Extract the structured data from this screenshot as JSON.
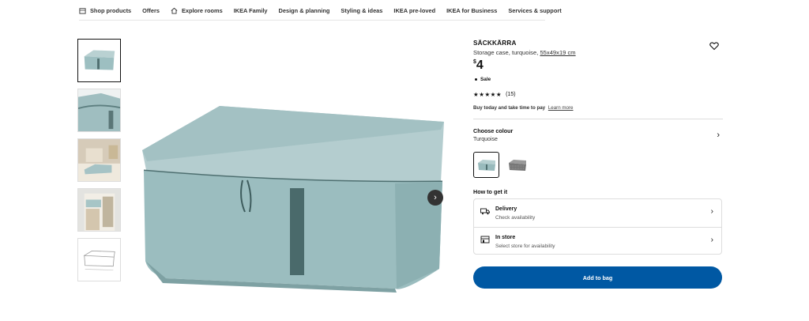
{
  "nav": {
    "items": [
      {
        "label": "Shop products",
        "icon": "menu-icon"
      },
      {
        "label": "Offers"
      },
      {
        "label": "Explore rooms",
        "icon": "home-icon"
      },
      {
        "label": "IKEA Family"
      },
      {
        "label": "Design & planning"
      },
      {
        "label": "Styling & ideas"
      },
      {
        "label": "IKEA pre-loved"
      },
      {
        "label": "IKEA for Business"
      },
      {
        "label": "Services & support"
      }
    ]
  },
  "gallery": {
    "thumbnails": [
      "storage-case-front",
      "storage-case-closeup",
      "bedroom-scene",
      "wardrobe-scene",
      "dimension-drawing"
    ],
    "active_index": 0
  },
  "product": {
    "name": "SÄCKKÄRRA",
    "description": "Storage case, turquoise,",
    "dimensions": "55x49x19 cm",
    "currency": "$",
    "price": "4",
    "sale_label": "Sale",
    "stars": "★★★★★",
    "review_count": "(15)",
    "pay_later": "Buy today and take time to pay",
    "learn_more": "Learn more"
  },
  "colour": {
    "title": "Choose colour",
    "value": "Turquoise",
    "swatches": [
      {
        "name": "turquoise",
        "color": "#a9c6c8"
      },
      {
        "name": "grey-pattern",
        "color": "#8a8a8a"
      }
    ]
  },
  "delivery": {
    "heading": "How to get it",
    "options": [
      {
        "title": "Delivery",
        "subtitle": "Check availability",
        "icon": "truck-icon"
      },
      {
        "title": "In store",
        "subtitle": "Select store for availability",
        "icon": "store-icon"
      }
    ]
  },
  "cta": {
    "add_to_bag": "Add to bag",
    "accent": "#0058a3"
  }
}
